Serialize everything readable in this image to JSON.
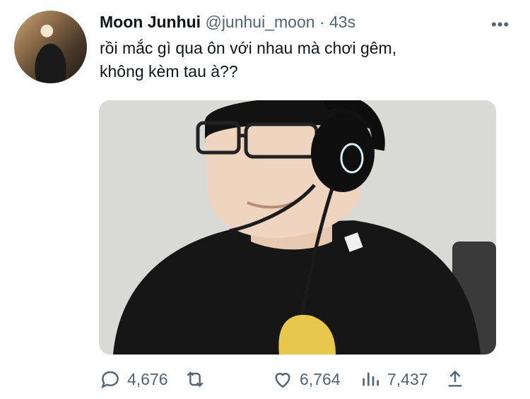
{
  "tweet": {
    "display_name": "Moon Junhui",
    "handle": "@junhui_moon",
    "separator": "·",
    "time": "43s",
    "more": "•••",
    "text_line1": "rồi mắc gì qua ôn với nhau mà chơi gêm,",
    "text_line2": "không kèm tau à??"
  },
  "actions": {
    "reply_count": "4,676",
    "retweet_count": "",
    "like_count": "6,764",
    "views_count": "7,437"
  },
  "icons": {
    "reply": "reply-icon",
    "retweet": "retweet-icon",
    "like": "heart-icon",
    "views": "views-icon",
    "share": "share-icon",
    "more": "more-icon"
  },
  "colors": {
    "text": "#0f1419",
    "secondary": "#536471"
  }
}
